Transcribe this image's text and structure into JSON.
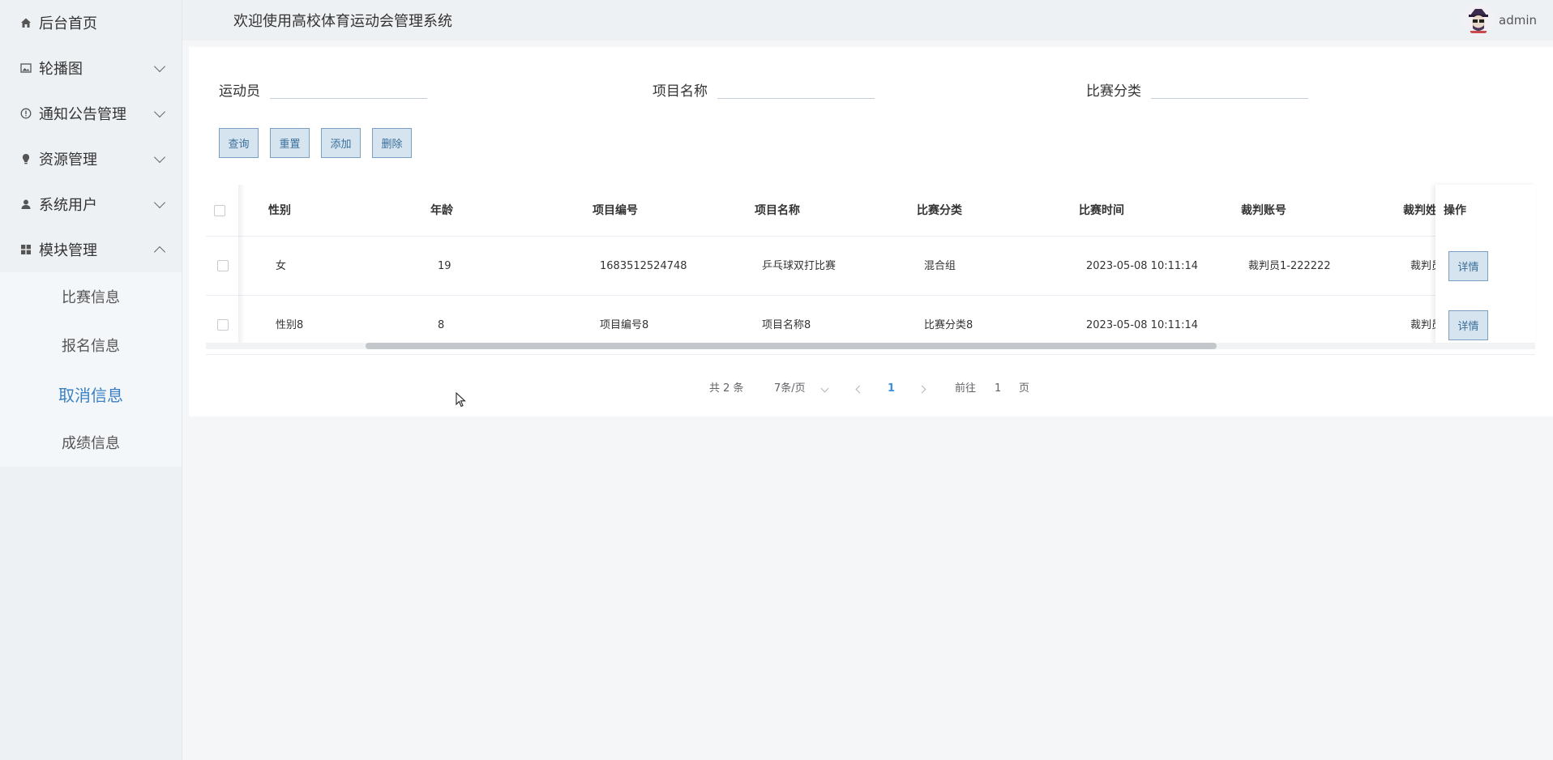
{
  "header": {
    "title": "欢迎使用高校体育运动会管理系统",
    "user": "admin"
  },
  "sidebar": {
    "items": [
      {
        "label": "后台首页",
        "icon": "home-icon"
      },
      {
        "label": "轮播图",
        "icon": "picture-icon"
      },
      {
        "label": "通知公告管理",
        "icon": "info-circle-icon"
      },
      {
        "label": "资源管理",
        "icon": "bulb-icon"
      },
      {
        "label": "系统用户",
        "icon": "user-icon"
      },
      {
        "label": "模块管理",
        "icon": "grid-icon"
      }
    ],
    "submenu": [
      "比赛信息",
      "报名信息",
      "取消信息",
      "成绩信息"
    ],
    "active_sub": "取消信息"
  },
  "search": {
    "fields": [
      {
        "label": "运动员",
        "value": ""
      },
      {
        "label": "项目名称",
        "value": ""
      },
      {
        "label": "比赛分类",
        "value": ""
      }
    ]
  },
  "buttons": {
    "query": "查询",
    "reset": "重置",
    "add": "添加",
    "delete": "删除"
  },
  "table": {
    "columns": [
      "性别",
      "年龄",
      "项目编号",
      "项目名称",
      "比赛分类",
      "比赛时间",
      "裁判账号",
      "裁判姓",
      "操作"
    ],
    "rows": [
      [
        "女",
        "19",
        "1683512524748",
        "乒乓球双打比赛",
        "混合组",
        "2023-05-08 10:11:14",
        "裁判员1-222222",
        "裁判员"
      ],
      [
        "性别8",
        "8",
        "项目编号8",
        "项目名称8",
        "比赛分类8",
        "2023-05-08 10:11:14",
        "",
        "裁判员"
      ]
    ],
    "action_label": "详情"
  },
  "pagination": {
    "total": "共 2 条",
    "page_size": "7条/页",
    "current": "1",
    "goto_prefix": "前往",
    "goto_value": "1",
    "goto_suffix": "页"
  },
  "colors": {
    "accent": "#3a7fc4",
    "button_bg": "#d6e4f0",
    "button_border": "#7a9fc0"
  }
}
